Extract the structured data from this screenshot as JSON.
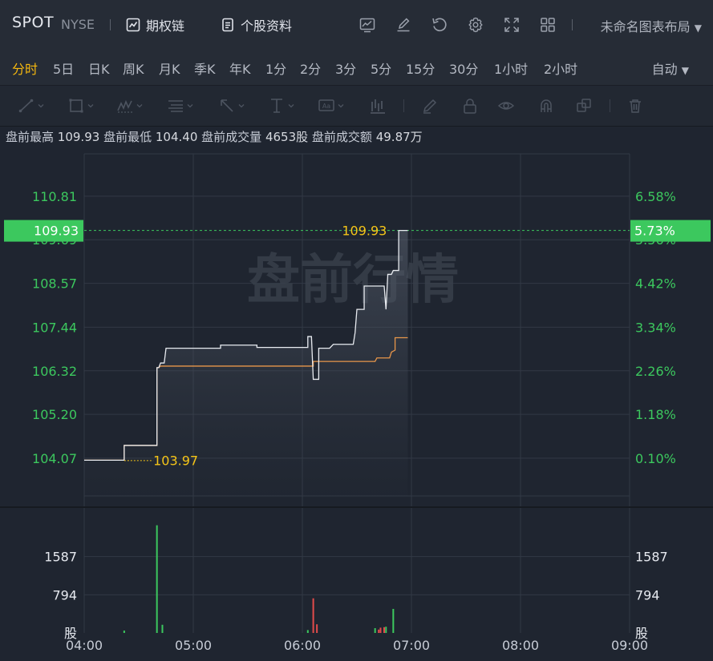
{
  "header": {
    "symbol": "SPOT",
    "exchange": "NYSE",
    "options_chain": "期权链",
    "stock_profile": "个股资料",
    "layout_name": "未命名图表布局",
    "icons": [
      "indicator-icon",
      "draw-icon",
      "undo-icon",
      "settings-icon",
      "fullscreen-icon",
      "grid-layout-icon"
    ]
  },
  "periods": {
    "items": [
      "分时",
      "5日",
      "日K",
      "周K",
      "月K",
      "季K",
      "年K",
      "1分",
      "2分",
      "3分",
      "5分",
      "15分",
      "30分",
      "1小时",
      "2小时"
    ],
    "active": "分时",
    "auto": "自动"
  },
  "drawing_tools": [
    "trend-line-icon",
    "rectangle-icon",
    "pattern-icon",
    "fibonacci-icon",
    "arrow-icon",
    "measure-icon",
    "text-note-icon",
    "bars-pattern-icon",
    "brush-icon",
    "lock-icon",
    "visibility-icon",
    "magnet-icon",
    "clone-icon",
    "trash-icon"
  ],
  "premarket": {
    "high_label": "盘前最高",
    "high": "109.93",
    "low_label": "盘前最低",
    "low": "104.40",
    "vol_label": "盘前成交量",
    "vol": "4653股",
    "amt_label": "盘前成交额",
    "amt": "49.87万"
  },
  "colors": {
    "up": "#3cc85e",
    "price_line": "#e8ebf0",
    "avg_line": "#e8964a",
    "label_yellow": "#f5c518",
    "grid": "#323945",
    "vol_up": "#3cc85e",
    "vol_down": "#e24b4b"
  },
  "chart_data": {
    "type": "line",
    "watermark": "盘前行情",
    "price_ticks": [
      "110.81",
      "109.69",
      "108.57",
      "107.44",
      "106.32",
      "105.20",
      "104.07"
    ],
    "pct_ticks": [
      "6.58%",
      "5.56%",
      "4.42%",
      "3.34%",
      "2.26%",
      "1.18%",
      "0.10%"
    ],
    "ylim": [
      103.1,
      111.9
    ],
    "current_price": "109.93",
    "current_pct": "5.73%",
    "high_label": "109.93",
    "low_label": "103.97",
    "x_ticks": [
      "04:00",
      "05:00",
      "06:00",
      "07:00",
      "08:00",
      "09:00"
    ],
    "x_range_min": [
      0,
      300
    ],
    "price": [
      [
        0,
        104.02
      ],
      [
        22,
        104.02
      ],
      [
        22,
        104.4
      ],
      [
        40,
        104.4
      ],
      [
        40,
        106.4
      ],
      [
        41,
        106.4
      ],
      [
        42,
        106.52
      ],
      [
        44,
        106.52
      ],
      [
        45,
        106.9
      ],
      [
        75,
        106.9
      ],
      [
        75,
        106.98
      ],
      [
        95,
        106.98
      ],
      [
        95,
        106.92
      ],
      [
        123,
        106.92
      ],
      [
        123,
        107.2
      ],
      [
        125,
        107.2
      ],
      [
        126,
        106.1
      ],
      [
        129,
        106.1
      ],
      [
        129,
        106.9
      ],
      [
        135,
        106.9
      ],
      [
        137,
        107.0
      ],
      [
        148,
        107.0
      ],
      [
        149,
        107.3
      ],
      [
        150,
        107.9
      ],
      [
        154,
        107.9
      ],
      [
        154,
        108.5
      ],
      [
        165,
        108.5
      ],
      [
        166,
        107.9
      ],
      [
        167,
        108.8
      ],
      [
        169,
        108.8
      ],
      [
        170,
        108.9
      ],
      [
        173,
        108.9
      ],
      [
        173,
        109.93
      ],
      [
        178,
        109.93
      ]
    ],
    "avg": [
      [
        0,
        104.02
      ],
      [
        22,
        104.02
      ],
      [
        22,
        104.4
      ],
      [
        40,
        104.4
      ],
      [
        40,
        106.4
      ],
      [
        41,
        106.4
      ],
      [
        42,
        106.44
      ],
      [
        75,
        106.44
      ],
      [
        126,
        106.44
      ],
      [
        126,
        106.56
      ],
      [
        160,
        106.56
      ],
      [
        161,
        106.65
      ],
      [
        168,
        106.65
      ],
      [
        169,
        106.8
      ],
      [
        171,
        106.85
      ],
      [
        171,
        107.17
      ],
      [
        178,
        107.17
      ]
    ],
    "volume_ticks": [
      "1587",
      "794"
    ],
    "volume_unit": "股",
    "vol_max": 2381,
    "volume": [
      [
        22,
        50,
        "up"
      ],
      [
        40,
        2238,
        "up"
      ],
      [
        43,
        170,
        "up"
      ],
      [
        123,
        60,
        "up"
      ],
      [
        126,
        720,
        "down"
      ],
      [
        128,
        180,
        "down"
      ],
      [
        160,
        100,
        "up"
      ],
      [
        162,
        70,
        "down"
      ],
      [
        163,
        110,
        "down"
      ],
      [
        165,
        120,
        "down"
      ],
      [
        166,
        130,
        "up"
      ],
      [
        170,
        500,
        "up"
      ]
    ]
  }
}
